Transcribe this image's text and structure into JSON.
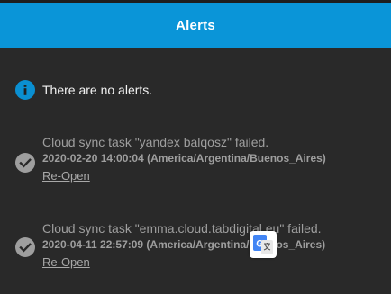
{
  "header": {
    "title": "Alerts"
  },
  "status": {
    "message": "There are no alerts.",
    "icon": "info-icon",
    "icon_color": "#0a8fd1"
  },
  "alerts": [
    {
      "title": "Cloud sync task \"yandex balqosz\" failed.",
      "datetime": "2020-02-20 14:00:04 (America/Argentina/Buenos_Aires)",
      "action": "Re-Open",
      "icon": "check-circle-icon"
    },
    {
      "title": "Cloud sync task \"emma.cloud.tabdigital.eu\" failed.",
      "datetime": "2020-04-11 22:57:09 (America/Argentina/Buenos_Aires)",
      "action": "Re-Open",
      "icon": "check-circle-icon"
    }
  ],
  "overlay": {
    "icon": "google-translate-icon"
  },
  "colors": {
    "header_bg": "#0a95d8",
    "panel_bg": "#292929",
    "muted_text": "#9e9e9e"
  }
}
